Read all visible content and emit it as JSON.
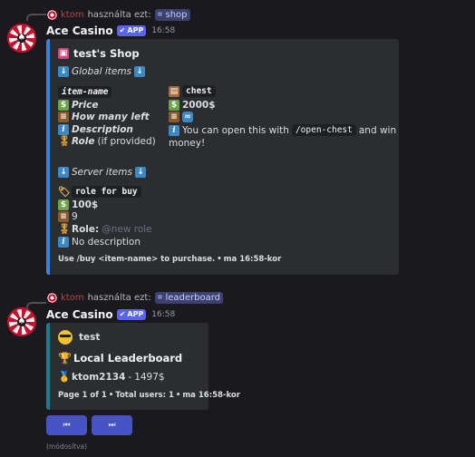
{
  "messages": [
    {
      "reply": {
        "user": "ktom",
        "verb": "használta ezt:",
        "command": "shop"
      },
      "author": "Ace Casino",
      "badge": "APP",
      "time": "16:58",
      "embed": {
        "title": "test's Shop",
        "global_header": "Global items",
        "left_col": {
          "item_name": "item-name",
          "price_label": "Price",
          "how_many_label": "How many left",
          "description_label": "Description",
          "role_label": "Role",
          "role_suffix": "(if provided)"
        },
        "right_col": {
          "item_name": "chest",
          "price": "2000$",
          "description_pre": "You can open this with",
          "description_code": "/open-chest",
          "description_post": "and win",
          "description_wrap": "money!"
        },
        "server_header": "Server items",
        "server_item": {
          "name": "role for buy",
          "price": "100$",
          "count": "9",
          "role_label": "Role:",
          "role_value": "@new role",
          "description": "No description"
        },
        "footer": "Use /buy <item-name> to purchase.",
        "footer_time": "ma 16:58-kor"
      }
    },
    {
      "reply": {
        "user": "ktom",
        "verb": "használta ezt:",
        "command": "leaderboard"
      },
      "author": "Ace Casino",
      "badge": "APP",
      "time": "16:58",
      "embed": {
        "author": "test",
        "title": "Local Leaderboard",
        "entry_name": "ktom2134",
        "entry_value": "1497$",
        "footer_page": "Page 1 of 1",
        "footer_total": "Total users: 1",
        "footer_time": "ma 16:58-kor"
      },
      "buttons": [
        {
          "icon": "previous-icon",
          "glyph": "⏮"
        },
        {
          "icon": "next-icon",
          "glyph": "⏭"
        }
      ],
      "edited": "(módosítva)"
    }
  ],
  "colors": {
    "background": "#1a1a1e",
    "embed_bg": "#2b2d31",
    "embed_shop_border": "#3b83d9",
    "embed_leaderboard_border": "#1e7a8c",
    "badge": "#5865f2",
    "button": "#4752c4"
  }
}
